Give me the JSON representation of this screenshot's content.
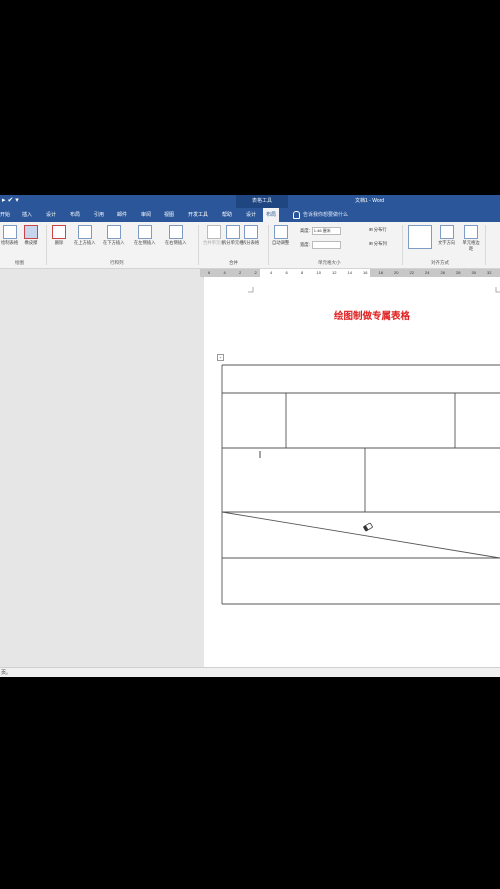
{
  "titlebar": {
    "context_tab": "表格工具",
    "document_title": "文档1 - Word"
  },
  "tabs": [
    "开始",
    "插入",
    "设计",
    "布局",
    "引用",
    "邮件",
    "审阅",
    "视图",
    "开发工具",
    "帮助",
    "设计",
    "布局"
  ],
  "active_tab": "布局",
  "tell_me": "告诉我你想要做什么",
  "ribbon": {
    "draw_group": {
      "label": "绘图",
      "draw_table": "绘制表格",
      "eraser": "橡皮擦"
    },
    "rows_cols_group": {
      "label": "行和列",
      "delete": "删除",
      "insert_above": "在上方插入",
      "insert_below": "在下方插入",
      "insert_left": "在左侧插入",
      "insert_right": "在右侧插入"
    },
    "merge_group": {
      "label": "合并",
      "merge_cells": "合并单元格",
      "split_cells": "拆分单元格",
      "split_table": "拆分表格"
    },
    "cell_size_group": {
      "label": "单元格大小",
      "autofit": "自动调整",
      "height_label": "高度:",
      "height_value": "1.46 厘米",
      "width_label": "宽度:",
      "distribute_rows": "分布行",
      "distribute_cols": "分布列"
    },
    "align_group": {
      "label": "对齐方式",
      "text_direction": "文字方向",
      "cell_margins": "单元格边距"
    }
  },
  "ruler_ticks": [
    "6",
    "4",
    "2",
    "2",
    "4",
    "6",
    "8",
    "10",
    "12",
    "14",
    "16",
    "18",
    "20",
    "22",
    "24",
    "26",
    "28",
    "30",
    "32"
  ],
  "document": {
    "title": "绘图制做专属表格"
  },
  "statusbar": {
    "text": "页。"
  },
  "colors": {
    "ribbon_blue": "#2b579a",
    "title_red": "#e02020",
    "table_line": "#555555"
  }
}
